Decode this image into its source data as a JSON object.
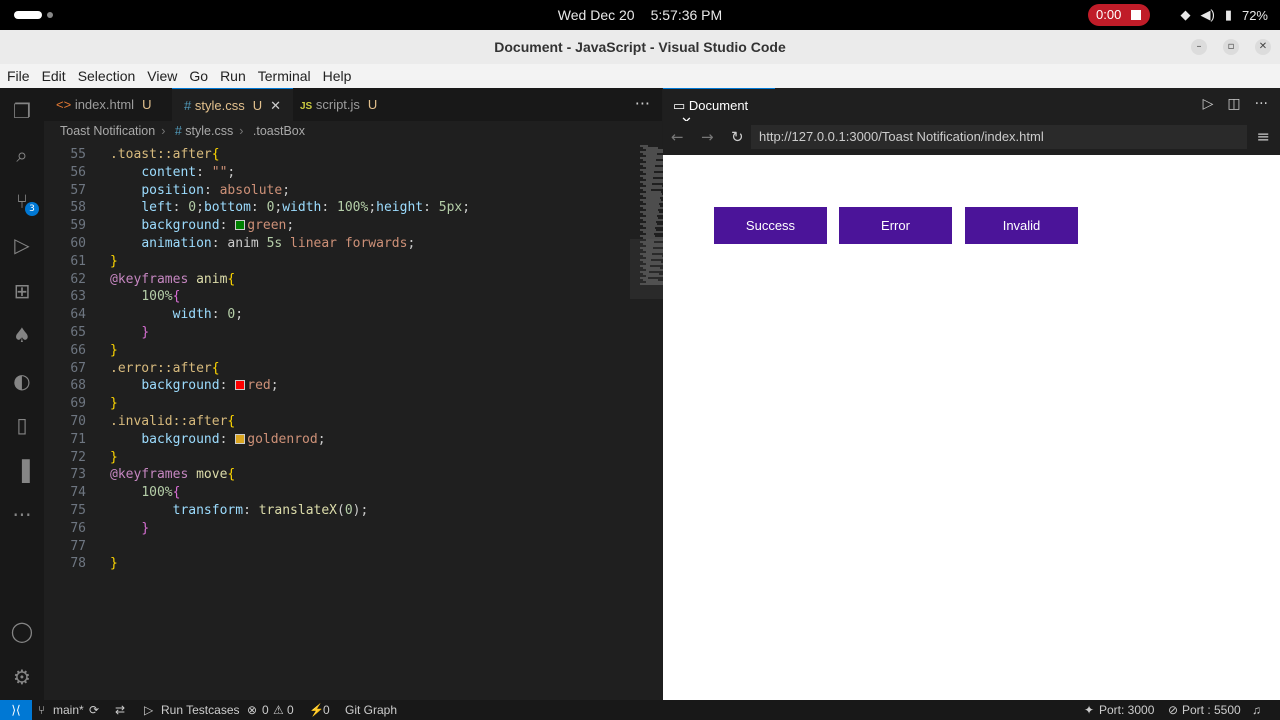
{
  "system": {
    "date": "Wed Dec 20",
    "time": "5:57:36 PM",
    "recording": "0:00",
    "battery": "72%"
  },
  "window": {
    "title": "Document - JavaScript - Visual Studio Code"
  },
  "menu": [
    "File",
    "Edit",
    "Selection",
    "View",
    "Go",
    "Run",
    "Terminal",
    "Help"
  ],
  "activity_badge": "3",
  "tabs": [
    {
      "icon": "<>",
      "name": "index.html",
      "status": "U"
    },
    {
      "icon": "#",
      "name": "style.css",
      "status": "U",
      "close": "✕"
    },
    {
      "icon": "JS",
      "name": "script.js",
      "status": "U"
    }
  ],
  "breadcrumb": {
    "folder": "Toast Notification",
    "file": "style.css",
    "symbol": ".toastBox"
  },
  "code_lines": [
    {
      "n": "55",
      "html": "<span class='sel'>.toast::after</span><span class='brace'>{</span>"
    },
    {
      "n": "56",
      "html": "    <span class='prop'>content</span><span class='plain'>: </span><span class='val'>\"\"</span><span class='plain'>;</span>"
    },
    {
      "n": "57",
      "html": "    <span class='prop'>position</span><span class='plain'>: </span><span class='val'>absolute</span><span class='plain'>;</span>"
    },
    {
      "n": "58",
      "html": "    <span class='prop'>left</span><span class='plain'>: </span><span class='num'>0</span><span class='plain'>;</span><span class='prop'>bottom</span><span class='plain'>: </span><span class='num'>0</span><span class='plain'>;</span><span class='prop'>width</span><span class='plain'>: </span><span class='num'>100%</span><span class='plain'>;</span><span class='prop'>height</span><span class='plain'>: </span><span class='num'>5px</span><span class='plain'>;</span>"
    },
    {
      "n": "59",
      "html": "    <span class='prop'>background</span><span class='plain'>: </span><span class='swatch' style='background:#008000'></span><span class='val'>green</span><span class='plain'>;</span>"
    },
    {
      "n": "60",
      "html": "    <span class='prop'>animation</span><span class='plain'>: </span><span class='plain'>anim </span><span class='num'>5s</span><span class='val'> linear forwards</span><span class='plain'>;</span>"
    },
    {
      "n": "61",
      "html": "<span class='brace'>}</span>"
    },
    {
      "n": "62",
      "html": "<span class='at'>@keyframes</span><span class='plain'> </span><span class='kw'>anim</span><span class='brace'>{</span>"
    },
    {
      "n": "63",
      "html": "    <span class='num'>100%</span><span class='brace2'>{</span>"
    },
    {
      "n": "64",
      "html": "        <span class='prop'>width</span><span class='plain'>: </span><span class='num'>0</span><span class='plain'>;</span>"
    },
    {
      "n": "65",
      "html": "    <span class='brace2'>}</span>"
    },
    {
      "n": "66",
      "html": "<span class='brace'>}</span>"
    },
    {
      "n": "67",
      "html": "<span class='sel'>.error::after</span><span class='brace'>{</span>"
    },
    {
      "n": "68",
      "html": "    <span class='prop'>background</span><span class='plain'>: </span><span class='swatch' style='background:#ff0000'></span><span class='val'>red</span><span class='plain'>;</span>"
    },
    {
      "n": "69",
      "html": "<span class='brace'>}</span>"
    },
    {
      "n": "70",
      "html": "<span class='sel'>.invalid::after</span><span class='brace'>{</span>"
    },
    {
      "n": "71",
      "html": "    <span class='prop'>background</span><span class='plain'>: </span><span class='swatch' style='background:#daa520'></span><span class='val'>goldenrod</span><span class='plain'>;</span>"
    },
    {
      "n": "72",
      "html": "<span class='brace'>}</span>"
    },
    {
      "n": "73",
      "html": "<span class='at'>@keyframes</span><span class='plain'> </span><span class='kw'>move</span><span class='brace'>{</span>"
    },
    {
      "n": "74",
      "html": "    <span class='num'>100%</span><span class='brace2'>{</span>"
    },
    {
      "n": "75",
      "html": "        <span class='prop'>transform</span><span class='plain'>: </span><span class='kw'>translateX</span><span class='plain'>(</span><span class='num'>0</span><span class='plain'>);</span>"
    },
    {
      "n": "76",
      "html": "    <span class='brace2'>}</span>"
    },
    {
      "n": "77",
      "html": ""
    },
    {
      "n": "78",
      "html": "<span class='brace'>}</span>"
    }
  ],
  "preview": {
    "tab": "Document",
    "tab_close": "✕",
    "url": "http://127.0.0.1:3000/Toast Notification/index.html",
    "buttons": [
      "Success",
      "Error",
      "Invalid"
    ]
  },
  "status": {
    "branch": "main*",
    "run_testcases": "Run Testcases",
    "errors": "0",
    "warnings": "0",
    "ports_detected": "0",
    "git_graph": "Git Graph",
    "port_3000": "Port: 3000",
    "port_5500": "Port : 5500"
  },
  "colors": {
    "accent": "#0078d4",
    "button": "#4b1499",
    "record": "#c01c28"
  }
}
